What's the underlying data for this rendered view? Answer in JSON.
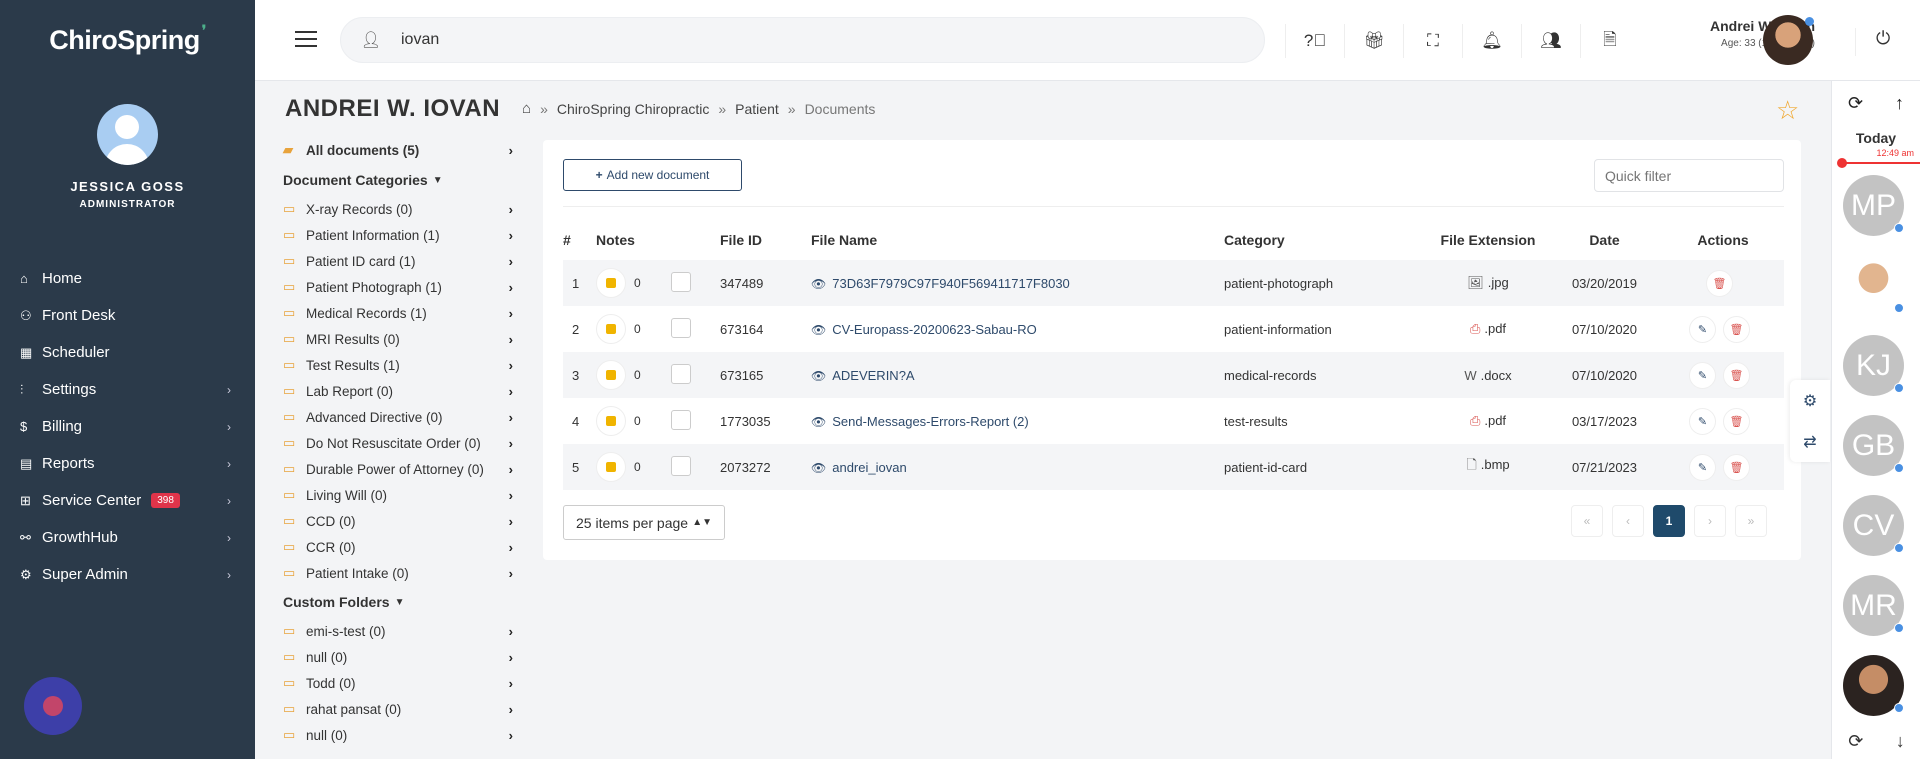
{
  "sidebar": {
    "brand": "ChiroSpring",
    "user_name": "JESSICA GOSS",
    "user_role": "ADMINISTRATOR",
    "nav": [
      {
        "label": "Home",
        "icon": "home-icon",
        "has_chevron": false
      },
      {
        "label": "Front Desk",
        "icon": "user-check-icon",
        "has_chevron": false
      },
      {
        "label": "Scheduler",
        "icon": "calendar-icon",
        "has_chevron": false
      },
      {
        "label": "Settings",
        "icon": "sliders-icon",
        "has_chevron": true
      },
      {
        "label": "Billing",
        "icon": "dollar-icon",
        "has_chevron": true
      },
      {
        "label": "Reports",
        "icon": "file-icon",
        "has_chevron": true
      },
      {
        "label": "Service Center",
        "icon": "grid-icon",
        "has_chevron": true,
        "badge": "398"
      },
      {
        "label": "GrowthHub",
        "icon": "handshake-icon",
        "has_chevron": true
      },
      {
        "label": "Super Admin",
        "icon": "gear-icon",
        "has_chevron": true
      }
    ]
  },
  "topbar": {
    "search_value": "iovan",
    "user_name": "Andrei W. Iovan",
    "user_age": "Age: 33 (12/03/1989)"
  },
  "header": {
    "patient_name": "ANDREI W. IOVAN",
    "breadcrumb": [
      "ChiroSpring Chiropractic",
      "Patient",
      "Documents"
    ]
  },
  "folders": {
    "all": "All documents (5)",
    "categories_title": "Document Categories",
    "categories": [
      "X-ray Records (0)",
      "Patient Information (1)",
      "Patient ID card (1)",
      "Patient Photograph (1)",
      "Medical Records (1)",
      "MRI Results (0)",
      "Test Results (1)",
      "Lab Report (0)",
      "Advanced Directive (0)",
      "Do Not Resuscitate Order (0)",
      "Durable Power of Attorney (0)",
      "Living Will (0)",
      "CCD (0)",
      "CCR (0)",
      "Patient Intake (0)"
    ],
    "custom_title": "Custom Folders",
    "custom": [
      "emi-s-test (0)",
      "null (0)",
      "Todd (0)",
      "rahat pansat (0)",
      "null (0)"
    ]
  },
  "documents": {
    "add_label": "Add new document",
    "quick_filter_placeholder": "Quick filter",
    "columns": [
      "#",
      "Notes",
      "File ID",
      "File Name",
      "Category",
      "File Extension",
      "Date",
      "Actions"
    ],
    "rows": [
      {
        "num": "1",
        "notes": "0",
        "file_id": "347489",
        "file_name": "73D63F7979C97F940F569411717F8030",
        "category": "patient-photograph",
        "ext": ".jpg",
        "ext_icon": "image-file-icon",
        "date": "03/20/2019",
        "editable": false
      },
      {
        "num": "2",
        "notes": "0",
        "file_id": "673164",
        "file_name": "CV-Europass-20200623-Sabau-RO",
        "category": "patient-information",
        "ext": ".pdf",
        "ext_icon": "pdf-file-icon",
        "date": "07/10/2020",
        "editable": true
      },
      {
        "num": "3",
        "notes": "0",
        "file_id": "673165",
        "file_name": "ADEVERIN?A",
        "category": "medical-records",
        "ext": ".docx",
        "ext_icon": "word-file-icon",
        "date": "07/10/2020",
        "editable": true
      },
      {
        "num": "4",
        "notes": "0",
        "file_id": "1773035",
        "file_name": "Send-Messages-Errors-Report (2)",
        "category": "test-results",
        "ext": ".pdf",
        "ext_icon": "pdf-file-icon",
        "date": "03/17/2023",
        "editable": true
      },
      {
        "num": "5",
        "notes": "0",
        "file_id": "2073272",
        "file_name": "andrei_iovan",
        "category": "patient-id-card",
        "ext": ".bmp",
        "ext_icon": "file-icon",
        "date": "07/21/2023",
        "editable": true
      }
    ],
    "per_page": "25 items per page",
    "pager": [
      "«",
      "‹",
      "1",
      "›",
      "»"
    ]
  },
  "schedule": {
    "today": "Today",
    "now_time": "12:49 am",
    "appointments": [
      "MP",
      "",
      "KJ",
      "GB",
      "CV",
      "MR",
      ""
    ]
  },
  "colors": {
    "sidebar_bg": "#2b3a4a",
    "accent": "#2e4a6b",
    "danger": "#d9534f",
    "badge": "#e0344a",
    "folder": "#e8a33c"
  }
}
